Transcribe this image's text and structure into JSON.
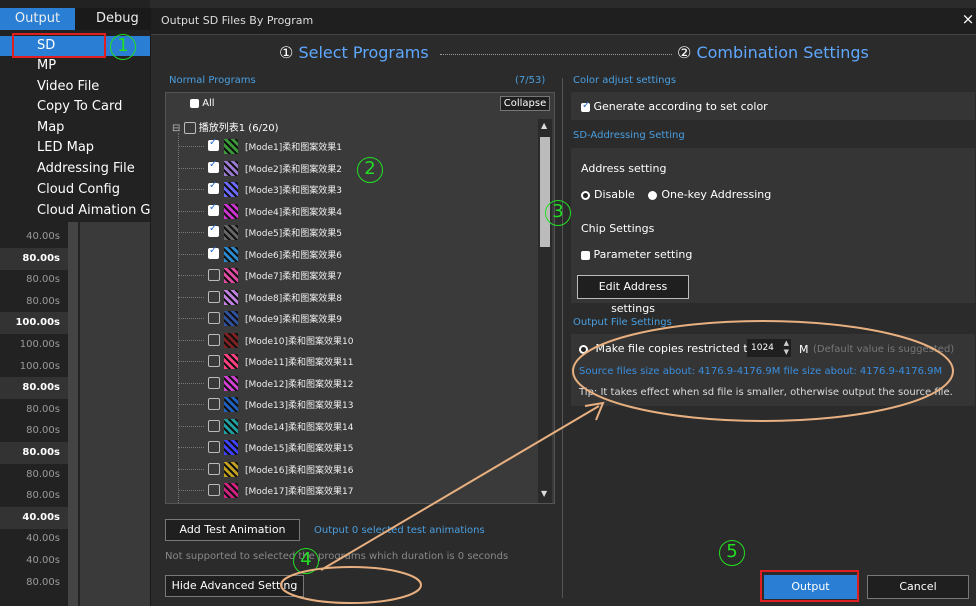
{
  "left_menu": {
    "tabs": [
      "Output",
      "Debug"
    ],
    "items": [
      "SD",
      "MP",
      "Video File",
      "Copy To Card",
      "Map",
      "LED Map",
      "Addressing File",
      "Cloud Config",
      "Cloud Aimation Gzi"
    ],
    "times": [
      "40.00s",
      "80.00s",
      "80.00s",
      "80.00s",
      "100.00s",
      "100.00s",
      "100.00s",
      "80.00s",
      "80.00s",
      "80.00s",
      "80.00s",
      "80.00s",
      "80.00s",
      "40.00s",
      "40.00s",
      "40.00s",
      "80.00s"
    ]
  },
  "dialog": {
    "title": "Output SD Files By Program",
    "close": "×",
    "step1": {
      "num": "①",
      "label": "Select Programs"
    },
    "step2": {
      "num": "②",
      "label": "Combination Settings"
    }
  },
  "programs": {
    "section_label": "Normal Programs",
    "count": "(7/53)",
    "all_label": "All",
    "collapse_label": "Collapse",
    "group_label": "播放列表1 (6/20)",
    "items": [
      {
        "name": "[Mode1]柔和图案效果1",
        "checked": true,
        "color": "#3a9a3a"
      },
      {
        "name": "[Mode2]柔和图案效果2",
        "checked": true,
        "color": "#9a7ad0"
      },
      {
        "name": "[Mode3]柔和图案效果3",
        "checked": true,
        "color": "#6a6aff"
      },
      {
        "name": "[Mode4]柔和图案效果4",
        "checked": true,
        "color": "#cc33cc"
      },
      {
        "name": "[Mode5]柔和图案效果5",
        "checked": true,
        "color": "#666666"
      },
      {
        "name": "[Mode6]柔和图案效果6",
        "checked": true,
        "color": "#2a8ad0"
      },
      {
        "name": "[Mode7]柔和图案效果7",
        "checked": false,
        "color": "#e04aa0"
      },
      {
        "name": "[Mode8]柔和图案效果8",
        "checked": false,
        "color": "#c080e0"
      },
      {
        "name": "[Mode9]柔和图案效果9",
        "checked": false,
        "color": "#3050a0"
      },
      {
        "name": "[Mode10]柔和图案效果10",
        "checked": false,
        "color": "#802020"
      },
      {
        "name": "[Mode11]柔和图案效果11",
        "checked": false,
        "color": "#ff4080"
      },
      {
        "name": "[Mode12]柔和图案效果12",
        "checked": false,
        "color": "#d040d0"
      },
      {
        "name": "[Mode13]柔和图案效果13",
        "checked": false,
        "color": "#2060c0"
      },
      {
        "name": "[Mode14]柔和图案效果14",
        "checked": false,
        "color": "#20a0a0"
      },
      {
        "name": "[Mode15]柔和图案效果15",
        "checked": false,
        "color": "#4040ff"
      },
      {
        "name": "[Mode16]柔和图案效果16",
        "checked": false,
        "color": "#c0a020"
      },
      {
        "name": "[Mode17]柔和图案效果17",
        "checked": false,
        "color": "#d02080"
      }
    ],
    "add_test_label": "Add Test Animation",
    "test_count": "Output 0 selected test animations",
    "not_supported": "Not supported to selected the programs which duration is 0 seconds",
    "hide_advanced": "Hide Advanced Setting"
  },
  "combination": {
    "color_adjust_label": "Color adjust settings",
    "generate_color": "Generate according to set color",
    "sd_addressing_label": "SD-Addressing Setting",
    "address_setting": "Address setting",
    "disable": "Disable",
    "one_key": "One-key Addressing",
    "chip_settings": "Chip Settings",
    "parameter_setting": "Parameter setting",
    "edit_address": "Edit Address settings",
    "output_file_label": "Output File Settings",
    "make_copies": "Make file copies restricted to",
    "copies_value": "1024",
    "unit": "M",
    "default_hint": "(Default value is suggested)",
    "source_size": "Source files size about: 4176.9-4176.9M  file size about: 4176.9-4176.9M",
    "tip": "Tip: It takes effect when sd file is smaller, otherwise output the source file."
  },
  "footer": {
    "output": "Output",
    "cancel": "Cancel"
  },
  "annotations": [
    "1",
    "2",
    "3",
    "4",
    "5"
  ],
  "colors": {
    "accent": "#5fa8ff",
    "annotation": "#22dd22",
    "highlight_red": "#e02020",
    "arrow": "#e8b080",
    "selected": "#2a7fd4"
  }
}
